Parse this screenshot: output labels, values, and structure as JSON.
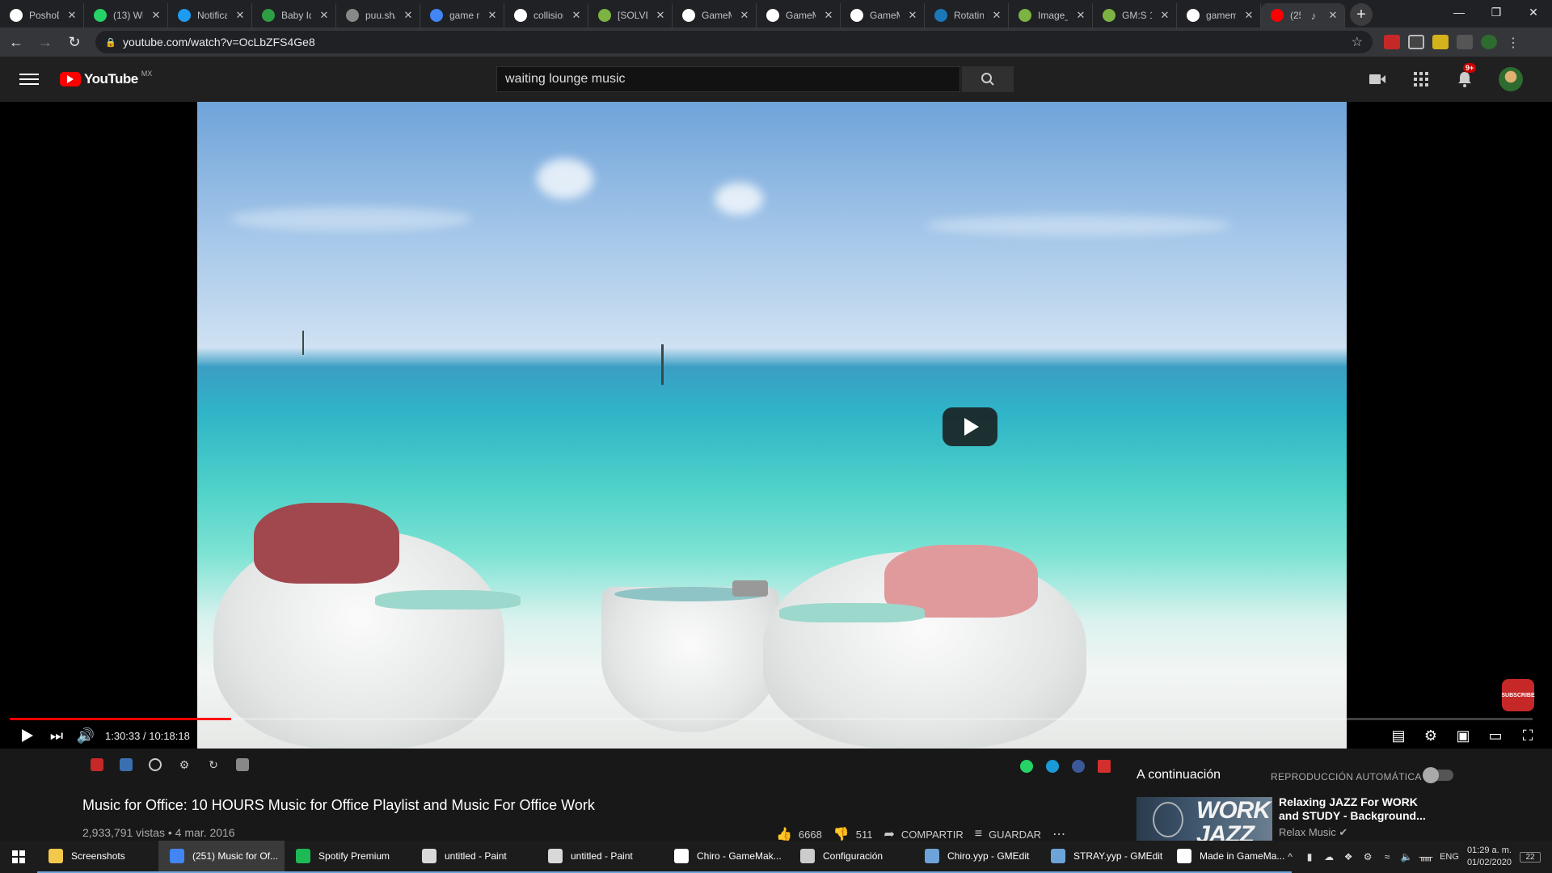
{
  "browser": {
    "tabs": [
      {
        "label": "PoshoD",
        "icon": "github-icon",
        "color": "#ffffff"
      },
      {
        "label": "(13) Wh",
        "icon": "whatsapp-icon",
        "color": "#25d366"
      },
      {
        "label": "Notifica",
        "icon": "notification-icon",
        "color": "#1d9bf0"
      },
      {
        "label": "Baby Id",
        "icon": "green-leaf-icon",
        "color": "#2e9e44"
      },
      {
        "label": "puu.sh/",
        "icon": "globe-icon",
        "color": "#888888"
      },
      {
        "label": "game m",
        "icon": "multicolor-icon",
        "color": "#4285f4"
      },
      {
        "label": "collision",
        "icon": "gamemaker-icon",
        "color": "#ffffff"
      },
      {
        "label": "[SOLVE]",
        "icon": "forum-icon",
        "color": "#7cb342"
      },
      {
        "label": "GameM",
        "icon": "gamemaker-icon",
        "color": "#ffffff"
      },
      {
        "label": "GameM",
        "icon": "gamemaker-icon",
        "color": "#ffffff"
      },
      {
        "label": "GameM",
        "icon": "gamemaker-icon",
        "color": "#ffffff"
      },
      {
        "label": "Rotatin",
        "icon": "steam-icon",
        "color": "#1b78b8"
      },
      {
        "label": "Image_",
        "icon": "forum-icon",
        "color": "#7cb342"
      },
      {
        "label": "GM:S 1",
        "icon": "forum-icon",
        "color": "#7cb342"
      },
      {
        "label": "gamem",
        "icon": "google-icon",
        "color": "#ffffff"
      },
      {
        "label": "(25",
        "icon": "youtube-icon",
        "color": "#ff0000",
        "active": true
      }
    ],
    "url": "youtube.com/watch?v=OcLbZFS4Ge8"
  },
  "youtube": {
    "logo_text": "YouTube",
    "country": "MX",
    "search_value": "waiting lounge music",
    "notifications_badge": "9+"
  },
  "player": {
    "current_time": "1:30:33",
    "separator": " / ",
    "duration": "10:18:18",
    "progress_fraction": 0.1456,
    "subscribe_watermark": "SUBSCRIBE"
  },
  "video": {
    "title": "Music for Office: 10 HOURS Music for Office Playlist and Music For Office Work",
    "views": "2,933,791 vistas",
    "dot": " • ",
    "date": "4 mar. 2016",
    "likes": "6668",
    "dislikes": "511",
    "share_label": "COMPARTIR",
    "save_label": "GUARDAR"
  },
  "sidebar": {
    "up_next": "A continuación",
    "autoplay": "REPRODUCCIÓN AUTOMÁTICA",
    "next_title": "Relaxing JAZZ For WORK and STUDY - Background...",
    "next_channel": "Relax Music",
    "thumb_text": "WORK JAZZ"
  },
  "taskbar": {
    "items": [
      {
        "label": "Screenshots",
        "color": "#f2c94c"
      },
      {
        "label": "(251) Music for Of...",
        "color": "#4285f4",
        "active": true
      },
      {
        "label": "Spotify Premium",
        "color": "#1db954"
      },
      {
        "label": "untitled - Paint",
        "color": "#d9d9d9"
      },
      {
        "label": "untitled - Paint",
        "color": "#d9d9d9"
      },
      {
        "label": "Chiro - GameMak...",
        "color": "#ffffff"
      },
      {
        "label": "Configuración",
        "color": "#cccccc"
      },
      {
        "label": "Chiro.yyp - GMEdit",
        "color": "#6ca4d9"
      },
      {
        "label": "STRAY.yyp - GMEdit",
        "color": "#6ca4d9"
      },
      {
        "label": "Made in GameMa...",
        "color": "#ffffff"
      }
    ],
    "lang": "ENG",
    "time": "01:29 a. m.",
    "date": "01/02/2020",
    "notifications": "22"
  }
}
